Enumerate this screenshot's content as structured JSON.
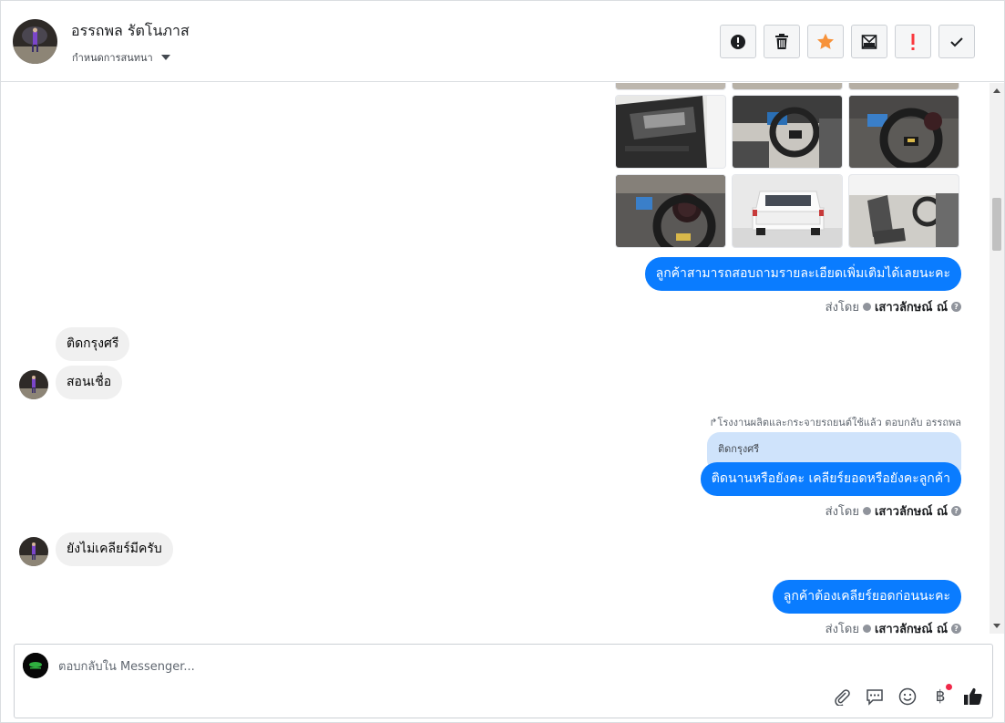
{
  "header": {
    "contact_name": "อรรถพล รัตโนภาส",
    "assign_label": "กำหนดการสนทนา",
    "toolbar": [
      {
        "name": "spam-info",
        "icon": "alert-circle-icon"
      },
      {
        "name": "delete",
        "icon": "trash-icon"
      },
      {
        "name": "star",
        "icon": "star-icon"
      },
      {
        "name": "mark-unread",
        "icon": "mail-icon"
      },
      {
        "name": "follow-up",
        "icon": "exclamation-icon"
      },
      {
        "name": "done",
        "icon": "check-icon"
      }
    ]
  },
  "colors": {
    "accent_blue": "#0a7cff",
    "incoming_bubble": "#f0f0f0",
    "quoted_bubble": "#cfe3fb",
    "star_orange": "#f7923a",
    "follow_up_red": "#fa383e"
  },
  "thread": {
    "photo_grid": [
      "door-interior-photo",
      "steering-dashboard-photo",
      "instrument-cluster-photo",
      "gauge-closeup-photo",
      "white-pickup-rear-photo",
      "seat-interior-photo"
    ],
    "messages": [
      {
        "dir": "out",
        "text": "ลูกค้าสามารถสอบถามรายละเอียดเพิ่มเติมได้เลยนะคะ"
      },
      {
        "dir": "in",
        "text": "ติดกรุงศรี"
      },
      {
        "dir": "in",
        "text": "สอนเชื่อ"
      },
      {
        "dir": "out",
        "text": "ติดนานหรือยังคะ เคลียร์ยอดหรือยังคะลูกค้า"
      },
      {
        "dir": "in",
        "text": "ยังไม่เคลียร์มีครับ"
      },
      {
        "dir": "out",
        "text": "ลูกค้าต้องเคลียร์ยอดก่อนนะคะ"
      }
    ],
    "sent_by_prefix": "ส่งโดย",
    "sent_by_name": "เสาวลักษณ์ ณ์",
    "help_glyph": "?",
    "reply_meta": "โรงงานผลิตและกระจายรถยนต์ใช้แล้ว ตอบกลับ อรรถพล",
    "quoted_text": "ติดกรุงศรี"
  },
  "composer": {
    "placeholder": "ตอบกลับใน Messenger...",
    "icons": [
      "paperclip-icon",
      "saved-reply-icon",
      "emoji-icon",
      "payment-icon",
      "thumbs-up-icon"
    ],
    "payment_glyph": "฿"
  }
}
